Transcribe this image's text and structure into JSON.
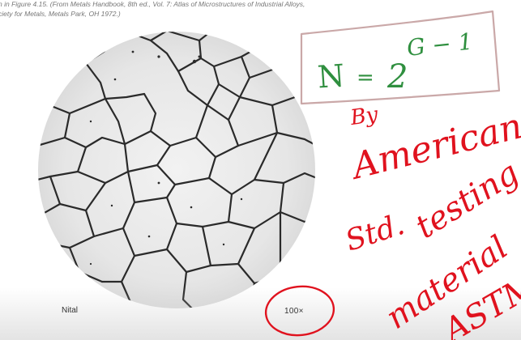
{
  "caption": {
    "line1": "n in Figure 4.15. (From Metals Handbook, 8th ed., Vol. 7: Atlas of Microstructures of Industrial Alloys,",
    "line2": "ciety for Metals, Metals Park, OH 1972.)"
  },
  "figure": {
    "etchant_label": "Nital",
    "magnification_label": "100×"
  },
  "annotations": {
    "formula": {
      "lhs": "N",
      "equals": "=",
      "base": "2",
      "exponent": "G − 1"
    },
    "note_by": "By",
    "note_american": "American",
    "note_std": "Std.",
    "note_testing": "testing",
    "note_material": "material",
    "note_astm": "ASTM",
    "ink_red": "#e0121e",
    "ink_green": "#2f8f3f",
    "box_color": "#caa8a8"
  }
}
